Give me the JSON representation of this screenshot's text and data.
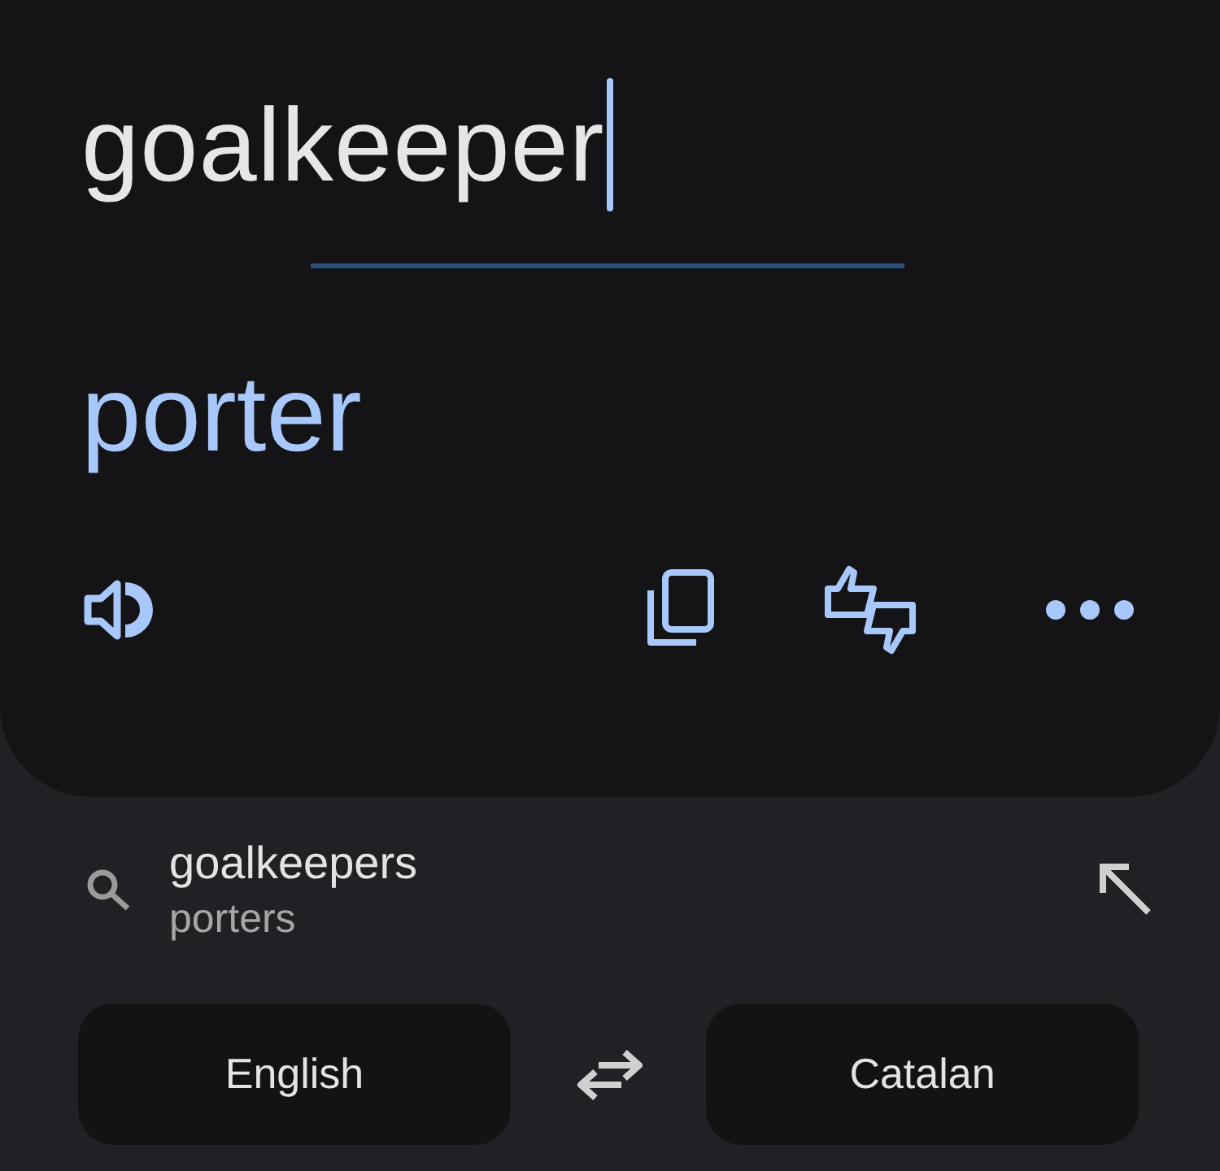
{
  "source": {
    "value": "goalkeeper",
    "focused": true
  },
  "translation": {
    "text": "porter"
  },
  "suggestions": [
    {
      "term": "goalkeepers",
      "translation": "porters"
    }
  ],
  "languages": {
    "source": "English",
    "target": "Catalan"
  }
}
